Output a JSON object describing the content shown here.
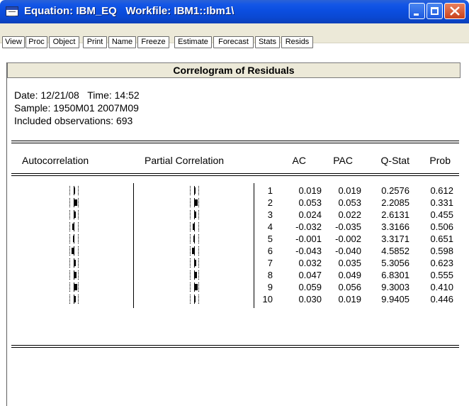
{
  "window": {
    "title": "Equation: IBM_EQ   Workfile: IBM1::Ibm1\\",
    "controls": [
      "minimize",
      "maximize",
      "close"
    ]
  },
  "toolbar": {
    "buttons": [
      "View",
      "Proc",
      "Object",
      "Print",
      "Name",
      "Freeze",
      "Estimate",
      "Forecast",
      "Stats",
      "Resids"
    ]
  },
  "header": {
    "title": "Correlogram of Residuals"
  },
  "info": {
    "date_line": "Date: 12/21/08   Time: 14:52",
    "sample_line": "Sample: 1950M01 2007M09",
    "obs_line": "Included observations: 693"
  },
  "table": {
    "headers": {
      "autocorrelation": "Autocorrelation",
      "partial_correlation": "Partial Correlation",
      "ac": "AC",
      "pac": "PAC",
      "qstat": "Q-Stat",
      "prob": "Prob"
    },
    "rows": [
      {
        "lag": "1",
        "ac": "0.019",
        "pac": "0.019",
        "q": "0.2576",
        "prob": "0.612",
        "ac_val": 0.019,
        "pac_val": 0.019
      },
      {
        "lag": "2",
        "ac": "0.053",
        "pac": "0.053",
        "q": "2.2085",
        "prob": "0.331",
        "ac_val": 0.053,
        "pac_val": 0.053
      },
      {
        "lag": "3",
        "ac": "0.024",
        "pac": "0.022",
        "q": "2.6131",
        "prob": "0.455",
        "ac_val": 0.024,
        "pac_val": 0.022
      },
      {
        "lag": "4",
        "ac": "-0.032",
        "pac": "-0.035",
        "q": "3.3166",
        "prob": "0.506",
        "ac_val": -0.032,
        "pac_val": -0.035
      },
      {
        "lag": "5",
        "ac": "-0.001",
        "pac": "-0.002",
        "q": "3.3171",
        "prob": "0.651",
        "ac_val": -0.001,
        "pac_val": -0.002
      },
      {
        "lag": "6",
        "ac": "-0.043",
        "pac": "-0.040",
        "q": "4.5852",
        "prob": "0.598",
        "ac_val": -0.043,
        "pac_val": -0.04
      },
      {
        "lag": "7",
        "ac": "0.032",
        "pac": "0.035",
        "q": "5.3056",
        "prob": "0.623",
        "ac_val": 0.032,
        "pac_val": 0.035
      },
      {
        "lag": "8",
        "ac": "0.047",
        "pac": "0.049",
        "q": "6.8301",
        "prob": "0.555",
        "ac_val": 0.047,
        "pac_val": 0.049
      },
      {
        "lag": "9",
        "ac": "0.059",
        "pac": "0.056",
        "q": "9.3003",
        "prob": "0.410",
        "ac_val": 0.059,
        "pac_val": 0.056
      },
      {
        "lag": "10",
        "ac": "0.030",
        "pac": "0.019",
        "q": "9.9405",
        "prob": "0.446",
        "ac_val": 0.03,
        "pac_val": 0.019
      }
    ]
  },
  "colors": {
    "titlebar": "#0b4ee0",
    "toolbar_bg": "#ece9d8",
    "close_button": "#c9421c"
  }
}
